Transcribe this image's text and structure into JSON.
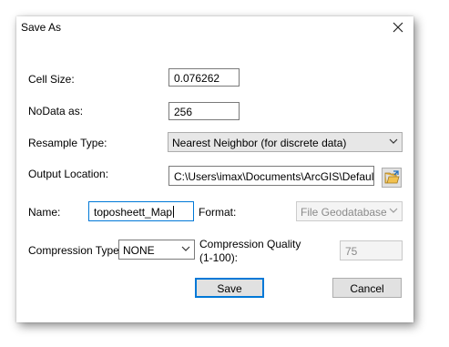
{
  "dialog": {
    "title": "Save As",
    "close_icon": "close-icon"
  },
  "form": {
    "cell_size": {
      "label": "Cell Size:",
      "value": "0.076262"
    },
    "nodata": {
      "label": "NoData as:",
      "value": "256"
    },
    "resample": {
      "label": "Resample Type:",
      "value": "Nearest Neighbor (for discrete data)"
    },
    "output_location": {
      "label": "Output Location:",
      "value": "C:\\Users\\imax\\Documents\\ArcGIS\\Default.gdb",
      "browse_icon": "folder-open-icon"
    },
    "name": {
      "label": "Name:",
      "value": "toposheett_Map"
    },
    "format": {
      "label": "Format:",
      "value": "File Geodatabase"
    },
    "compression_type": {
      "label": "Compression Type:",
      "value": "NONE"
    },
    "compression_quality": {
      "label_line1": "Compression Quality",
      "label_line2": "(1-100):",
      "value": "75"
    }
  },
  "buttons": {
    "save": "Save",
    "cancel": "Cancel"
  },
  "colors": {
    "focus_accent": "#0078d7",
    "button_face": "#e1e1e1"
  }
}
